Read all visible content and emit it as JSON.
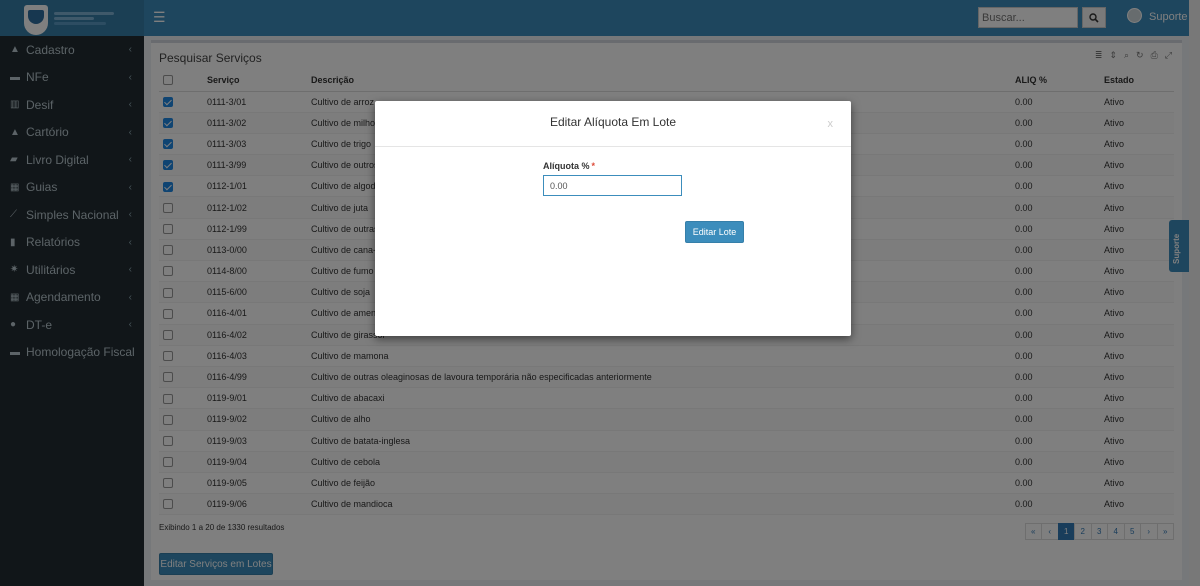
{
  "topbar": {
    "menu_icon": "hamburger-icon",
    "search_placeholder": "Buscar...",
    "search_icon": "search-icon",
    "user_name": "Suporte"
  },
  "sidebar": {
    "items": [
      {
        "label": "Cadastro",
        "icon": "user-icon",
        "glyph": "▲",
        "chevron": "‹"
      },
      {
        "label": "NFe",
        "icon": "file-icon",
        "glyph": "▬",
        "chevron": "‹"
      },
      {
        "label": "Desif",
        "icon": "bank-icon",
        "glyph": "▥",
        "chevron": "‹"
      },
      {
        "label": "Cartório",
        "icon": "user-icon",
        "glyph": "▲",
        "chevron": "‹"
      },
      {
        "label": "Livro Digital",
        "icon": "book-icon",
        "glyph": "▰",
        "chevron": "‹"
      },
      {
        "label": "Guias",
        "icon": "barcode-icon",
        "glyph": "▦",
        "chevron": "‹"
      },
      {
        "label": "Simples Nacional",
        "icon": "line-chart-icon",
        "glyph": "⟋",
        "chevron": "‹"
      },
      {
        "label": "Relatórios",
        "icon": "bar-chart-icon",
        "glyph": "▮",
        "chevron": "‹"
      },
      {
        "label": "Utilitários",
        "icon": "gear-icon",
        "glyph": "✷",
        "chevron": "‹"
      },
      {
        "label": "Agendamento",
        "icon": "calendar-icon",
        "glyph": "▦",
        "chevron": "‹"
      },
      {
        "label": "DT-e",
        "icon": "info-icon",
        "glyph": "●",
        "chevron": "‹"
      },
      {
        "label": "Homologação Fiscal",
        "icon": "file-icon",
        "glyph": "▬",
        "chevron": ""
      }
    ]
  },
  "panel": {
    "title": "Pesquisar Serviços",
    "tools": [
      "≣",
      "⇕",
      "⌕",
      "↻",
      "⎙",
      "⤢"
    ]
  },
  "table": {
    "headers": {
      "codigo": "Serviço",
      "descricao": "Descrição",
      "aliq": "ALIQ %",
      "estado": "Estado"
    },
    "rows": [
      {
        "checked": true,
        "codigo": "0111-3/01",
        "descricao": "Cultivo de arroz",
        "aliq": "0.00",
        "estado": "Ativo"
      },
      {
        "checked": true,
        "codigo": "0111-3/02",
        "descricao": "Cultivo de milho",
        "aliq": "0.00",
        "estado": "Ativo"
      },
      {
        "checked": true,
        "codigo": "0111-3/03",
        "descricao": "Cultivo de trigo",
        "aliq": "0.00",
        "estado": "Ativo"
      },
      {
        "checked": true,
        "codigo": "0111-3/99",
        "descricao": "Cultivo de outros ce",
        "aliq": "0.00",
        "estado": "Ativo"
      },
      {
        "checked": true,
        "codigo": "0112-1/01",
        "descricao": "Cultivo de algodão h",
        "aliq": "0.00",
        "estado": "Ativo"
      },
      {
        "checked": false,
        "codigo": "0112-1/02",
        "descricao": "Cultivo de juta",
        "aliq": "0.00",
        "estado": "Ativo"
      },
      {
        "checked": false,
        "codigo": "0112-1/99",
        "descricao": "Cultivo de outras fib",
        "aliq": "0.00",
        "estado": "Ativo"
      },
      {
        "checked": false,
        "codigo": "0113-0/00",
        "descricao": "Cultivo de cana-de-a",
        "aliq": "0.00",
        "estado": "Ativo"
      },
      {
        "checked": false,
        "codigo": "0114-8/00",
        "descricao": "Cultivo de fumo",
        "aliq": "0.00",
        "estado": "Ativo"
      },
      {
        "checked": false,
        "codigo": "0115-6/00",
        "descricao": "Cultivo de soja",
        "aliq": "0.00",
        "estado": "Ativo"
      },
      {
        "checked": false,
        "codigo": "0116-4/01",
        "descricao": "Cultivo de amendoir",
        "aliq": "0.00",
        "estado": "Ativo"
      },
      {
        "checked": false,
        "codigo": "0116-4/02",
        "descricao": "Cultivo de girassol",
        "aliq": "0.00",
        "estado": "Ativo"
      },
      {
        "checked": false,
        "codigo": "0116-4/03",
        "descricao": "Cultivo de mamona",
        "aliq": "0.00",
        "estado": "Ativo"
      },
      {
        "checked": false,
        "codigo": "0116-4/99",
        "descricao": "Cultivo de outras oleaginosas de lavoura temporária não especificadas anteriormente",
        "aliq": "0.00",
        "estado": "Ativo"
      },
      {
        "checked": false,
        "codigo": "0119-9/01",
        "descricao": "Cultivo de abacaxi",
        "aliq": "0.00",
        "estado": "Ativo"
      },
      {
        "checked": false,
        "codigo": "0119-9/02",
        "descricao": "Cultivo de alho",
        "aliq": "0.00",
        "estado": "Ativo"
      },
      {
        "checked": false,
        "codigo": "0119-9/03",
        "descricao": "Cultivo de batata-inglesa",
        "aliq": "0.00",
        "estado": "Ativo"
      },
      {
        "checked": false,
        "codigo": "0119-9/04",
        "descricao": "Cultivo de cebola",
        "aliq": "0.00",
        "estado": "Ativo"
      },
      {
        "checked": false,
        "codigo": "0119-9/05",
        "descricao": "Cultivo de feijão",
        "aliq": "0.00",
        "estado": "Ativo"
      },
      {
        "checked": false,
        "codigo": "0119-9/06",
        "descricao": "Cultivo de mandioca",
        "aliq": "0.00",
        "estado": "Ativo"
      }
    ]
  },
  "footer": {
    "info": "Exibindo 1 a 20 de 1330 resultados",
    "pages": [
      "«",
      "‹",
      "1",
      "2",
      "3",
      "4",
      "5",
      "›",
      "»"
    ],
    "active_page": "1",
    "batch_button": "Editar Serviços em Lotes"
  },
  "support_tab": "Suporte",
  "modal": {
    "title": "Editar Alíquota Em Lote",
    "close": "x",
    "field_label": "Alíquota %",
    "required_mark": "*",
    "field_value": "0.00",
    "submit": "Editar Lote"
  },
  "colors": {
    "primary": "#3c8dbc",
    "sidebar": "#222d32",
    "checkbox_on": "#1e88e5"
  }
}
